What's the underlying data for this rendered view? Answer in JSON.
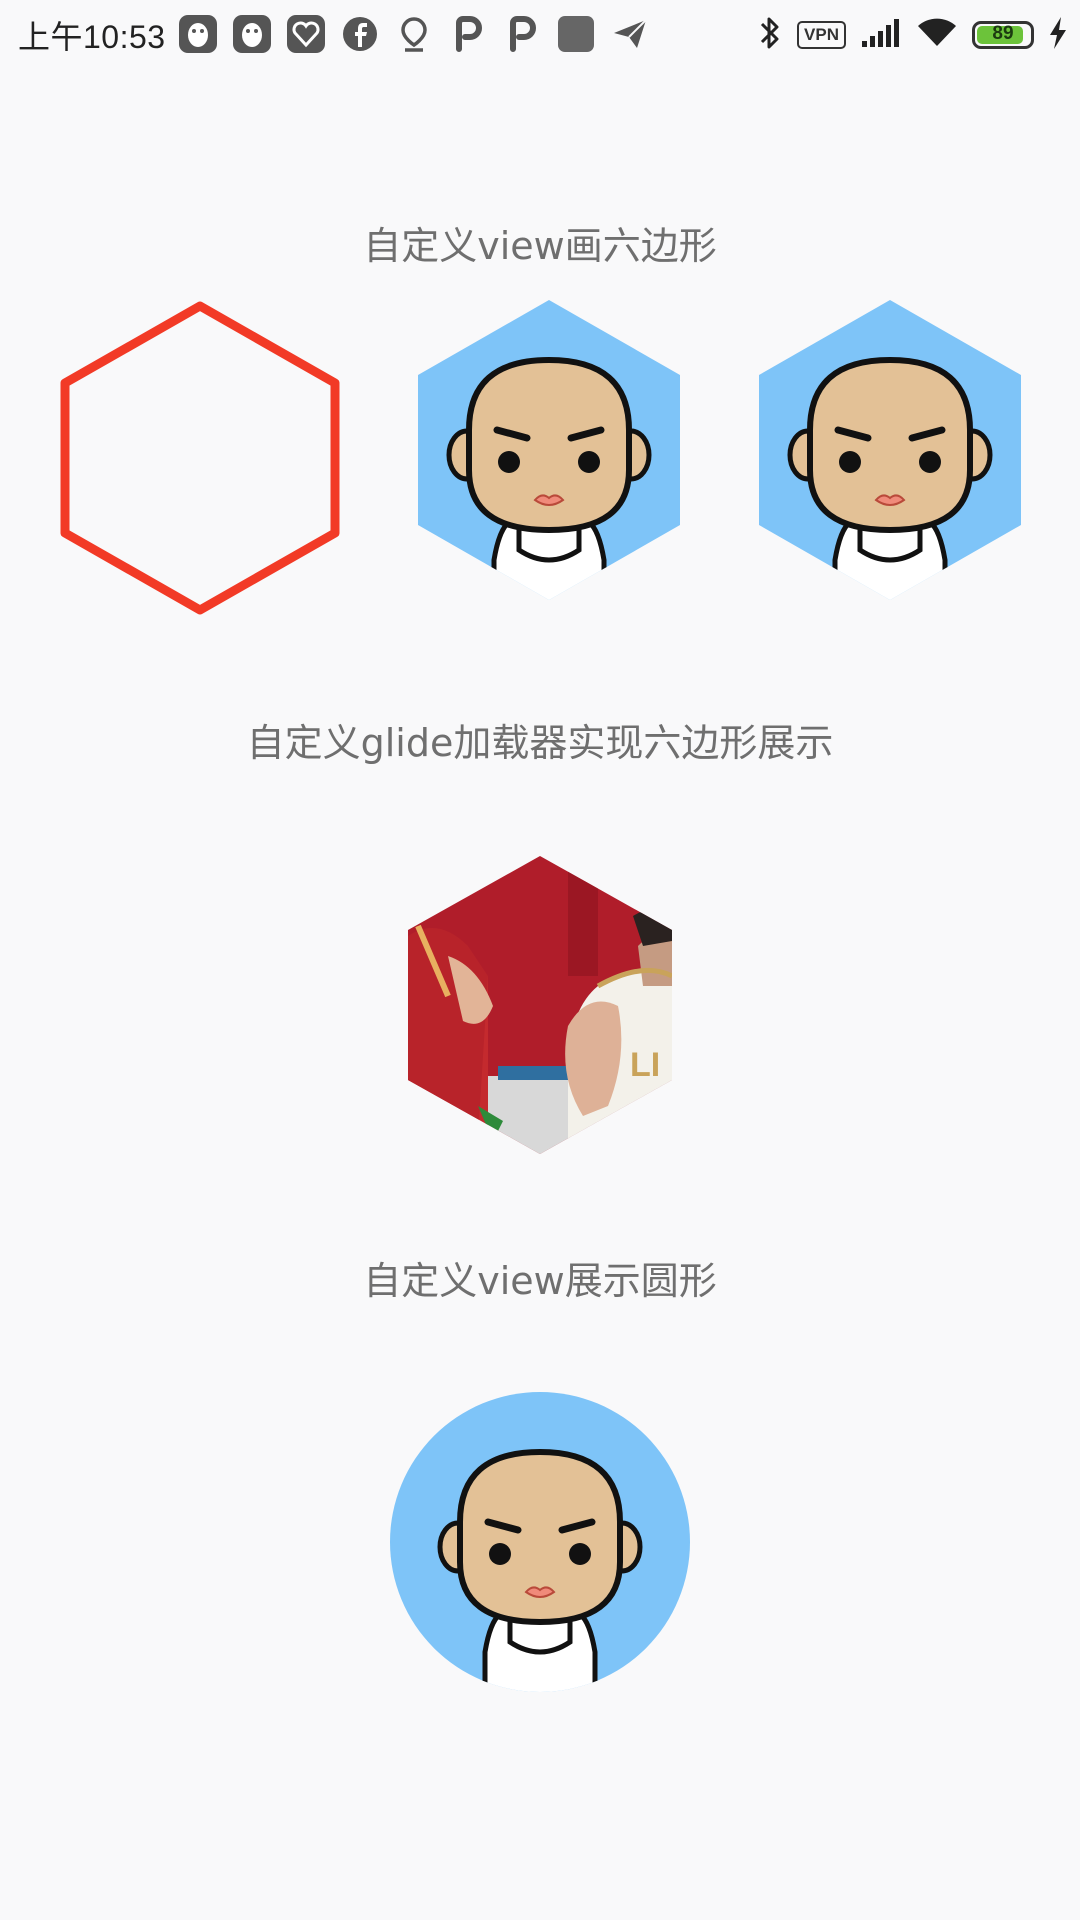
{
  "status_bar": {
    "time": "上午10:53",
    "notification_icons": [
      "qq-penguin-icon",
      "qq-penguin-icon",
      "heart-pattern-icon",
      "facebook-icon",
      "location-pin-icon",
      "p-app-icon",
      "p-app-icon",
      "app-square-icon",
      "send-arrow-icon"
    ],
    "vpn_label": "VPN",
    "battery_level": "89",
    "battery_fraction": 0.89,
    "accent_battery": "#6cc33a"
  },
  "sections": {
    "hexagon_view_title": "自定义view画六边形",
    "glide_loader_title": "自定义glide加载器实现六边形展示",
    "circle_view_title": "自定义view展示圆形"
  },
  "colors": {
    "hexagon_outline": "#f23a26",
    "avatar_background": "#7ec4f8",
    "avatar_skin": "#e3c196",
    "background": "#f9f9fa"
  }
}
